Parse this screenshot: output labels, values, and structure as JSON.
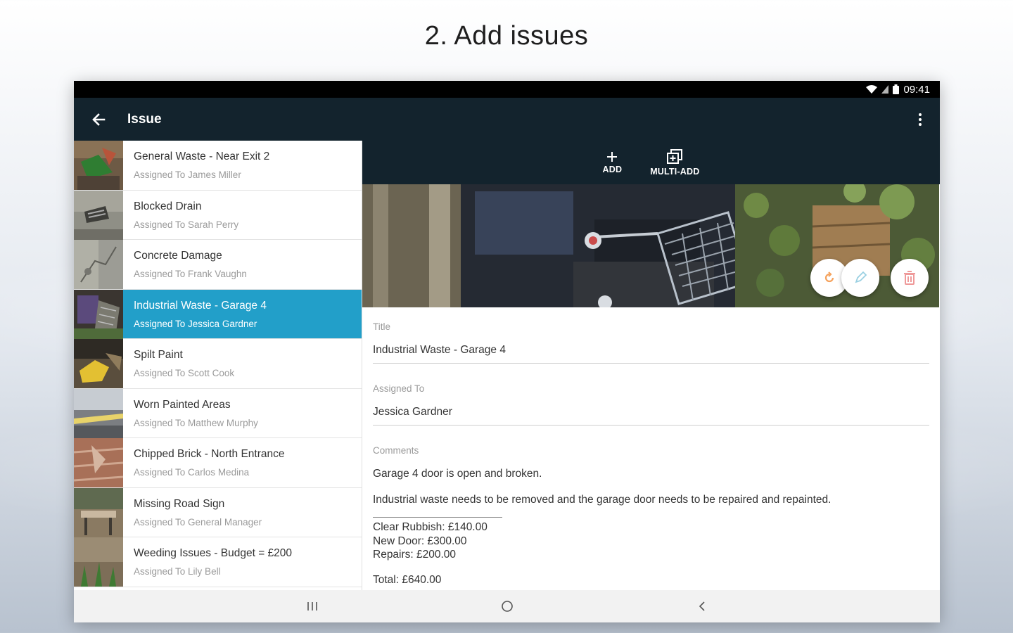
{
  "caption": "2.  Add issues",
  "status_bar": {
    "time": "09:41"
  },
  "app_bar": {
    "title": "Issue",
    "back_icon": "arrow-left-icon",
    "overflow_icon": "more-vert-icon"
  },
  "toolbar": {
    "add_label": "ADD",
    "multi_add_label": "MULTI-ADD"
  },
  "issues": [
    {
      "title": "General Waste - Near Exit 2",
      "assignee": "Assigned To James Miller",
      "selected": false
    },
    {
      "title": "Blocked Drain",
      "assignee": "Assigned To Sarah Perry",
      "selected": false
    },
    {
      "title": "Concrete Damage",
      "assignee": "Assigned To Frank Vaughn",
      "selected": false
    },
    {
      "title": "Industrial Waste - Garage 4",
      "assignee": "Assigned To Jessica Gardner",
      "selected": true
    },
    {
      "title": "Spilt Paint",
      "assignee": "Assigned To Scott Cook",
      "selected": false
    },
    {
      "title": "Worn Painted Areas",
      "assignee": "Assigned To Matthew Murphy",
      "selected": false
    },
    {
      "title": "Chipped Brick - North Entrance",
      "assignee": "Assigned To Carlos Medina",
      "selected": false
    },
    {
      "title": "Missing Road Sign",
      "assignee": "Assigned To General Manager",
      "selected": false
    },
    {
      "title": "Weeding Issues - Budget = £200",
      "assignee": "Assigned To Lily Bell",
      "selected": false
    }
  ],
  "detail": {
    "title_label": "Title",
    "title_value": "Industrial Waste - Garage 4",
    "assigned_label": "Assigned To",
    "assigned_value": "Jessica Gardner",
    "comments_label": "Comments",
    "comment_line_1": "Garage 4 door is open and broken.",
    "comment_line_2": "Industrial waste needs to be removed and the garage door needs to be repaired and repainted.",
    "cost_1": "Clear Rubbish: £140.00",
    "cost_2": "New Door: £300.00",
    "cost_3": "Repairs: £200.00",
    "total": "Total: £640.00"
  },
  "colors": {
    "app_bar": "#13232d",
    "selected_row": "#229fc9",
    "rotate_icon": "#f5a25d",
    "edit_icon": "#9ad0e2",
    "delete_icon": "#ef9a9a"
  }
}
